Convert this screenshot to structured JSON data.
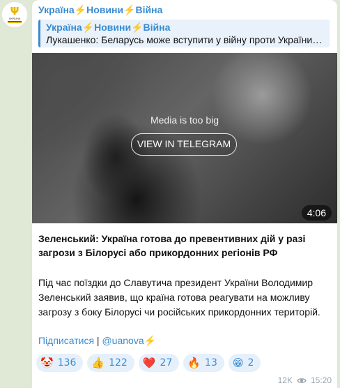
{
  "channel": {
    "name": "Україна⚡Новини⚡Війна",
    "avatar_text": "УКРАЇНА"
  },
  "reply": {
    "title": "Україна⚡Новини⚡Війна",
    "text": "Лукашенко: Беларусь може вступити у війну проти України …"
  },
  "media": {
    "message": "Media is too big",
    "button": "VIEW IN TELEGRAM",
    "duration": "4:06"
  },
  "post": {
    "title": "Зеленський: Україна готова до превентивних дій у разі загрози з Білорусі або прикордонних регіонів РФ",
    "body": "Під час поїздки до Славутича президент України Володимир Зеленський заявив, що країна готова реагувати на можливу загрозу з боку Білорусі чи російських прикордонних територій.",
    "subscribe_label": "Підписатися",
    "separator": " | ",
    "handle": "@uanova",
    "handle_suffix": "⚡"
  },
  "reactions": [
    {
      "emoji": "🤡",
      "icon": "clown-face-icon",
      "count": "136"
    },
    {
      "emoji": "👍",
      "icon": "thumbs-up-icon",
      "count": "122"
    },
    {
      "emoji": "❤️",
      "icon": "red-heart-icon",
      "count": "27"
    },
    {
      "emoji": "🔥",
      "icon": "fire-icon",
      "count": "13"
    },
    {
      "emoji": "😁",
      "icon": "grinning-face-icon",
      "count": "2"
    }
  ],
  "meta": {
    "views": "12K",
    "time": "15:20"
  },
  "colors": {
    "link": "#3a8bd0",
    "background": "#dfe9d6",
    "reaction_bg": "#e6f0fb"
  }
}
